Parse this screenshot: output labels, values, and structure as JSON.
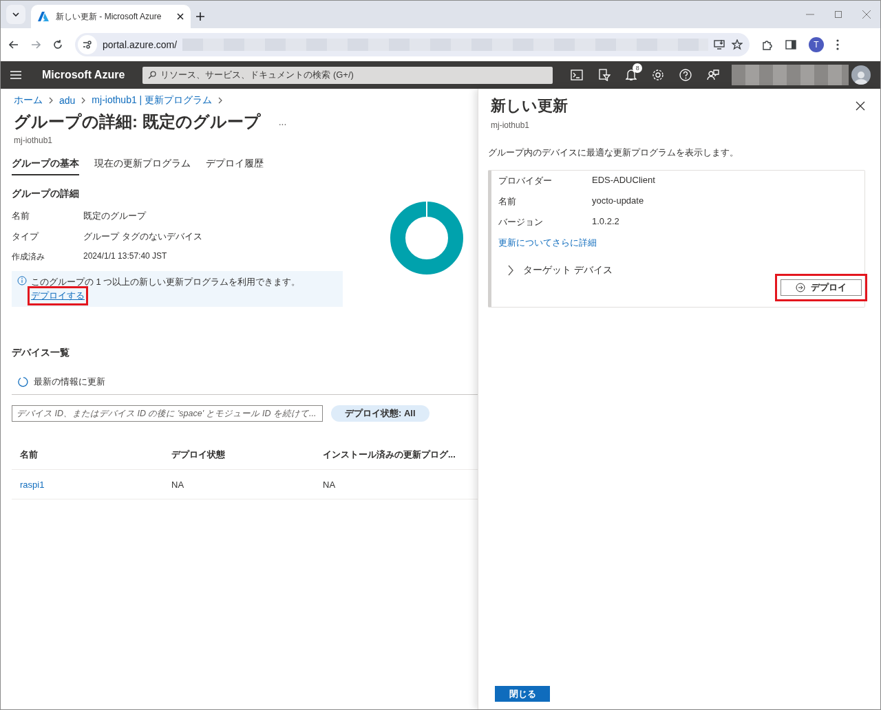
{
  "browser": {
    "tab_title": "新しい更新 - Microsoft Azure",
    "address": "portal.azure.com/",
    "avatar_letter": "T"
  },
  "portal": {
    "brand": "Microsoft Azure",
    "search_placeholder": "リソース、サービス、ドキュメントの検索 (G+/)",
    "notification_count": "8"
  },
  "breadcrumb": [
    "ホーム",
    "adu",
    "mj-iothub1 | 更新プログラム"
  ],
  "page": {
    "title": "グループの詳細: 既定のグループ",
    "more": "...",
    "subtitle": "mj-iothub1"
  },
  "tabs": [
    {
      "label": "グループの基本",
      "selected": true
    },
    {
      "label": "現在の更新プログラム",
      "selected": false
    },
    {
      "label": "デプロイ履歴",
      "selected": false
    }
  ],
  "details": {
    "heading": "グループの詳細",
    "rows": [
      {
        "label": "名前",
        "value": "既定のグループ"
      },
      {
        "label": "タイプ",
        "value": "グループ タグのないデバイス"
      },
      {
        "label": "作成済み",
        "value": "2024/1/1 13:57:40 JST"
      }
    ]
  },
  "notice": {
    "text": "このグループの 1 つ以上の新しい更新プログラムを利用できます。",
    "link": "デプロイする",
    "highlighted": true
  },
  "devices": {
    "heading": "デバイス一覧",
    "refresh": "最新の情報に更新",
    "search_placeholder": "デバイス ID、またはデバイス ID の後に 'space' とモジュール ID を続けて...",
    "filter": "デプロイ状態: All",
    "columns": [
      "名前",
      "デプロイ状態",
      "インストール済みの更新プログ..."
    ],
    "rows": [
      {
        "cells": [
          "raspi1",
          "NA",
          "NA"
        ]
      }
    ]
  },
  "panel": {
    "title": "新しい更新",
    "subtitle": "mj-iothub1",
    "description": "グループ内のデバイスに最適な更新プログラムを表示します。",
    "rows": [
      {
        "label": "プロバイダー",
        "value": "EDS-ADUClient"
      },
      {
        "label": "名前",
        "value": "yocto-update"
      },
      {
        "label": "バージョン",
        "value": "1.0.2.2"
      }
    ],
    "link": "更新についてさらに詳細",
    "target": {
      "label": "ターゲット デバイス",
      "expanded": false
    },
    "deploy": {
      "label": "デプロイ",
      "highlighted": true
    },
    "close_button": "閉じる"
  }
}
